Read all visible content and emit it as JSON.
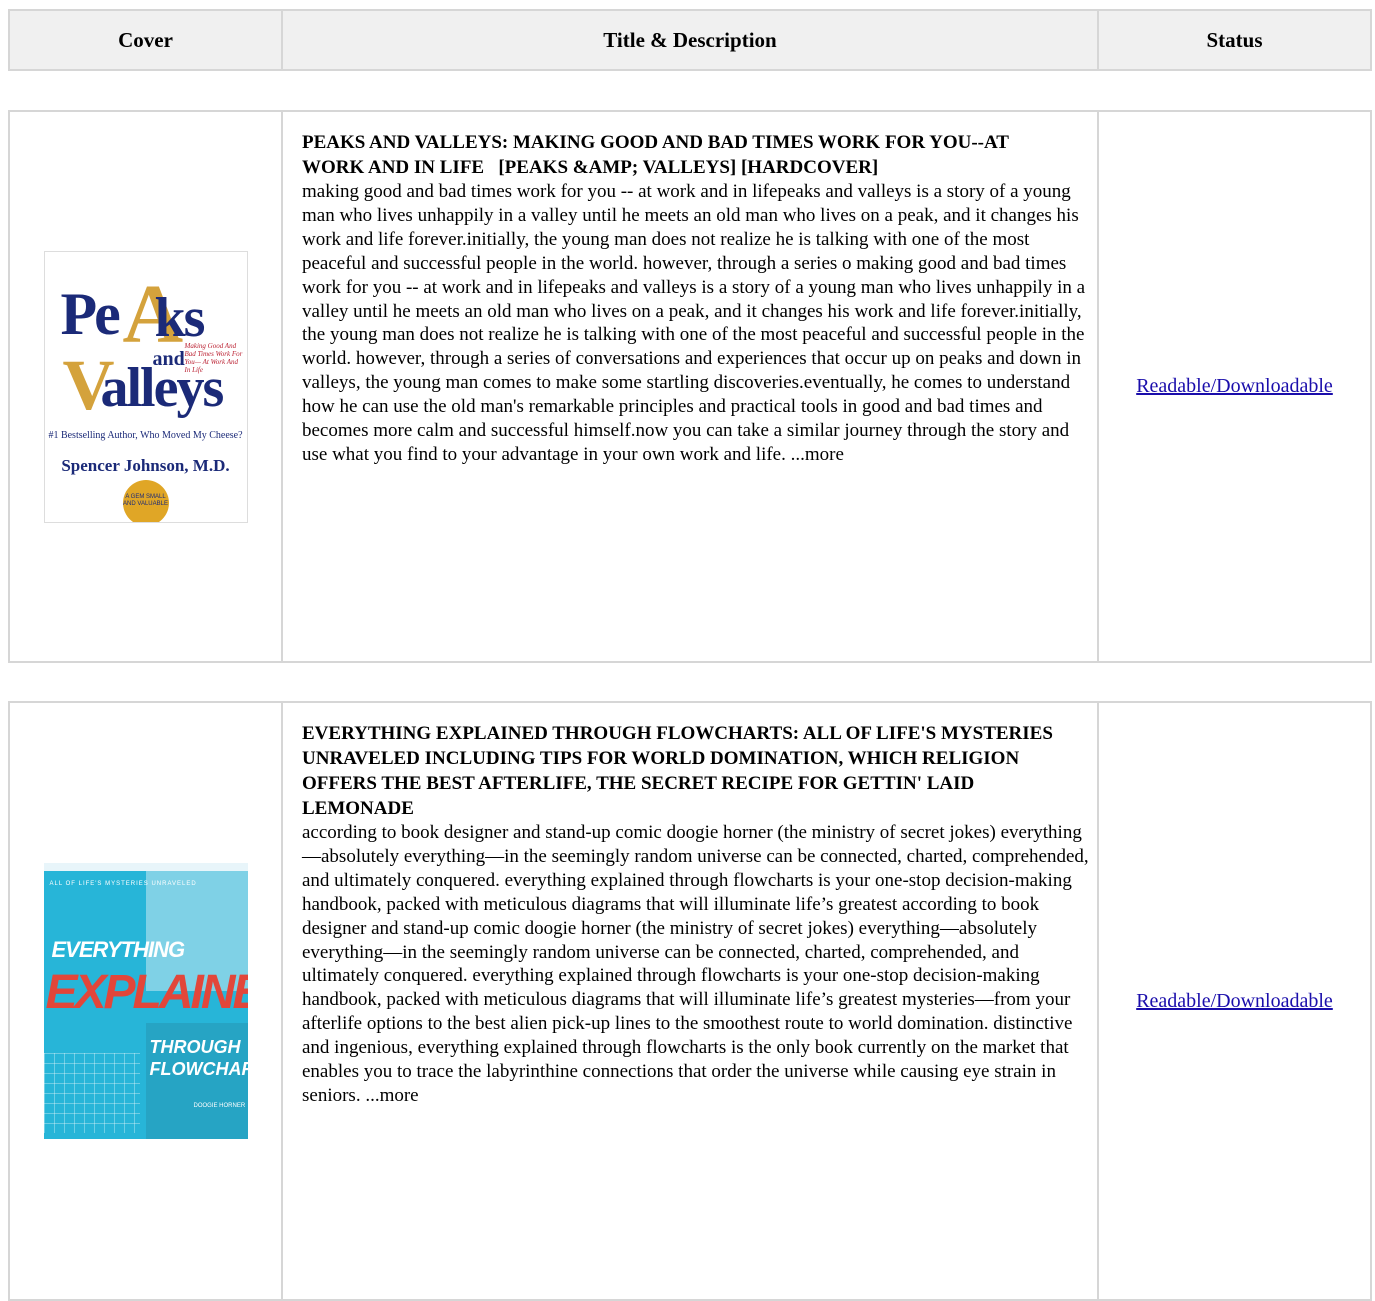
{
  "header": {
    "cover": "Cover",
    "title_desc": "Title & Description",
    "status": "Status"
  },
  "books": [
    {
      "cover": {
        "word_pe": "Pe",
        "word_a": "A",
        "word_ks": "ks",
        "word_and": "and",
        "word_v": "V",
        "word_alleys": "alleys",
        "tagline": "Making Good And Bad Times Work For You— At Work And In Life",
        "blurb": "#1 Bestselling Author, Who Moved My Cheese?",
        "author": "Spencer Johnson, M.D.",
        "seal": "A GEM SMALL AND VALUABLE"
      },
      "title": "PEAKS AND VALLEYS: MAKING GOOD AND BAD TIMES WORK FOR YOU--AT WORK AND IN LIFE   [PEAKS &AMP; VALLEYS] [HARDCOVER]",
      "description": "making good and bad times work for you -- at work and in lifepeaks and valleys is a story of a young man who lives unhappily in a valley until he meets an old man who lives on a peak, and it changes his work and life forever.initially, the young man does not realize he is talking with one of the most peaceful and successful people in the world. however, through a series o making good and bad times work for you -- at work and in lifepeaks and valleys is a story of a young man who lives unhappily in a valley until he meets an old man who lives on a peak, and it changes his work and life forever.initially, the young man does not realize he is talking with one of the most peaceful and successful people in the world. however, through a series of conversations and experiences that occur up on peaks and down in valleys, the young man comes to make some startling discoveries.eventually, he comes to understand how he can use the old man's remarkable principles and practical tools in good and bad times and becomes more calm and successful himself.now you can take a similar journey through the story and use what you find to your advantage in your own work and life. ...more",
      "status": "Readable/Downloadable"
    },
    {
      "cover": {
        "series": "ALL OF LIFE'S MYSTERIES UNRAVELED",
        "word_everything": "EVERYTHING",
        "word_explained": "EXPLAINED",
        "word_through": "THROUGH",
        "word_flowcharts": "FLOWCHARTS",
        "author": "DOOGIE HORNER"
      },
      "title": "EVERYTHING EXPLAINED THROUGH FLOWCHARTS: ALL OF LIFE'S MYSTERIES UNRAVELED INCLUDING TIPS FOR WORLD DOMINATION, WHICH RELIGION OFFERS THE BEST AFTERLIFE, THE SECRET RECIPE FOR GETTIN' LAID LEMONADE",
      "description": "according to book designer and stand-up comic doogie horner (the ministry of secret jokes) everything—absolutely everything—in the seemingly random universe can be connected, charted, comprehended, and ultimately conquered. everything explained through flowcharts is your one-stop decision-making handbook, packed with meticulous diagrams that will illuminate life’s greatest according to book designer and stand-up comic doogie horner (the ministry of secret jokes) everything—absolutely everything—in the seemingly random universe can be connected, charted, comprehended, and ultimately conquered. everything explained through flowcharts is your one-stop decision-making handbook, packed with meticulous diagrams that will illuminate life’s greatest mysteries—from your afterlife options to the best alien pick-up lines to the smoothest route to world domination. distinctive and ingenious, everything explained through flowcharts is the only book currently on the market that enables you to trace the labyrinthine connections that order the universe while causing eye strain in seniors. ...more",
      "status": "Readable/Downloadable"
    }
  ]
}
